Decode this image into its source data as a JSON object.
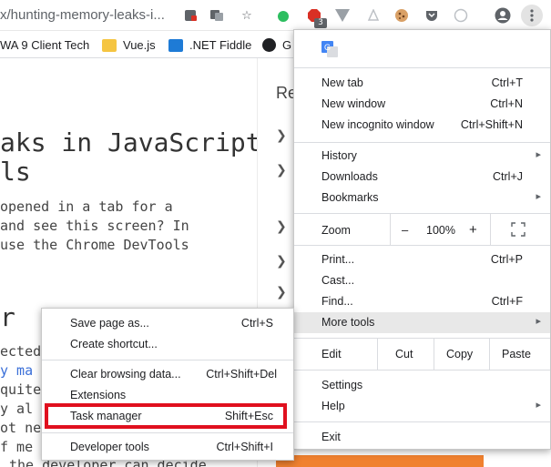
{
  "browser": {
    "url_text": "x/hunting-memory-leaks-i...",
    "extension_badge": "3",
    "toolbar_icons": [
      "not-secure-icon",
      "translate-icon",
      "bookmark-star-icon",
      "evernote-icon",
      "adblock-icon",
      "vue-devtools-icon",
      "extension-icon",
      "cookie-icon",
      "pocket-icon",
      "timer-icon",
      "profile-icon",
      "menu-dots-icon"
    ]
  },
  "bookmarks": [
    {
      "label": "WA 9 Client Tech",
      "icon": "bookmark-icon"
    },
    {
      "label": "Vue.js",
      "icon": "folder-icon"
    },
    {
      "label": ".NET Fiddle",
      "icon": "dotnet-icon"
    },
    {
      "label": "G",
      "icon": "github-icon"
    }
  ],
  "article": {
    "title_line1": "aks in JavaScript",
    "title_line2": "ls",
    "para_line1": " opened in a tab for a",
    "para_line2": "and see this screen? In",
    "para_line3": " use the Chrome DevTools",
    "section_glyph": "r",
    "body_line1": "ected",
    "body_line2": "y ma",
    "body_line3": "quite",
    "body_line4": "y al",
    "body_line5": "ot ne",
    "body_line6": "f me",
    "body_line7": "the developer can decide"
  },
  "sidebar": {
    "heading": "Re"
  },
  "main_menu": {
    "items": {
      "new_tab": {
        "label": "New tab",
        "shortcut": "Ctrl+T"
      },
      "new_window": {
        "label": "New window",
        "shortcut": "Ctrl+N"
      },
      "new_incognito": {
        "label": "New incognito window",
        "shortcut": "Ctrl+Shift+N"
      },
      "history": {
        "label": "History"
      },
      "downloads": {
        "label": "Downloads",
        "shortcut": "Ctrl+J"
      },
      "bookmarks": {
        "label": "Bookmarks"
      },
      "zoom": {
        "label": "Zoom",
        "minus": "–",
        "value": "100%",
        "plus": "+"
      },
      "print": {
        "label": "Print...",
        "shortcut": "Ctrl+P"
      },
      "cast": {
        "label": "Cast..."
      },
      "find": {
        "label": "Find...",
        "shortcut": "Ctrl+F"
      },
      "more_tools": {
        "label": "More tools"
      },
      "edit": {
        "label": "Edit",
        "cut": "Cut",
        "copy": "Copy",
        "paste": "Paste"
      },
      "settings": {
        "label": "Settings"
      },
      "help": {
        "label": "Help"
      },
      "exit": {
        "label": "Exit"
      }
    }
  },
  "more_tools_menu": {
    "items": {
      "save_page": {
        "label": "Save page as...",
        "shortcut": "Ctrl+S"
      },
      "create_shortcut": {
        "label": "Create shortcut..."
      },
      "clear_browsing": {
        "label": "Clear browsing data...",
        "shortcut": "Ctrl+Shift+Del"
      },
      "extensions": {
        "label": "Extensions"
      },
      "task_manager": {
        "label": "Task manager",
        "shortcut": "Shift+Esc"
      },
      "developer_tools": {
        "label": "Developer tools",
        "shortcut": "Ctrl+Shift+I"
      }
    }
  },
  "colors": {
    "highlight_border": "#e0101e",
    "hover_row": "#e8e8e8",
    "accent_orange": "#f0812f"
  }
}
